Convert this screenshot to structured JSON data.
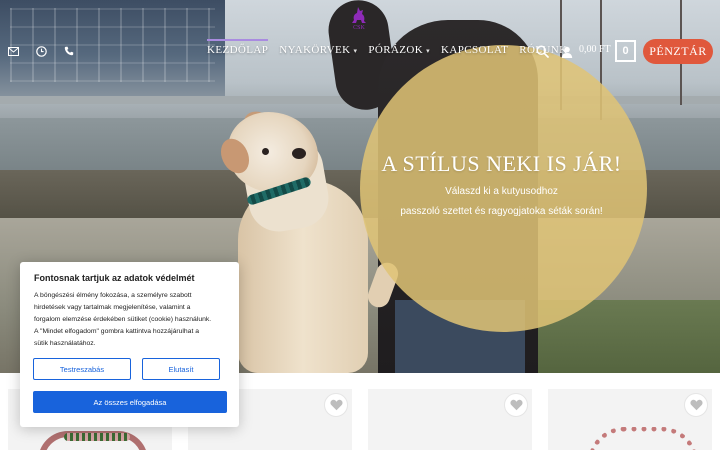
{
  "header": {
    "contact_icons": [
      "envelope-icon",
      "clock-icon",
      "phone-icon"
    ],
    "logo_icon": "dog-silhouette-icon",
    "nav": [
      {
        "label": "KEZDŐLAP",
        "has_dropdown": false,
        "active": true
      },
      {
        "label": "NYAKÖRVEK",
        "has_dropdown": true,
        "active": false
      },
      {
        "label": "PÓRÁZOK",
        "has_dropdown": true,
        "active": false
      },
      {
        "label": "KAPCSOLAT",
        "has_dropdown": false,
        "active": false
      },
      {
        "label": "RÓLUNK",
        "has_dropdown": false,
        "active": false
      }
    ],
    "cart_total": "0,00 FT",
    "cart_count": "0",
    "checkout_label": "PÉNZTÁR"
  },
  "hero": {
    "title": "A STÍLUS NEKI IS JÁR!",
    "subtitle_line1": "Válaszd ki a kutyusodhoz",
    "subtitle_line2": "passzoló szettet és ragyogjatoka séták során!"
  },
  "cookie": {
    "title": "Fontosnak tartjuk az adatok védelmét",
    "text_lines": [
      "A böngészési élmény fokozása, a személyre szabott",
      "hirdetések vagy tartalmak megjelenítése, valamint a",
      "forgalom elemzése érdekében sütiket (cookie) használunk.",
      "A \"Mindet elfogadom\" gombra kattintva hozzájárulhat a",
      "sütik használatához."
    ],
    "customize_label": "Testreszabás",
    "reject_label": "Elutasít",
    "accept_label": "Az összes elfogadása"
  },
  "products": {
    "cards": 4,
    "wishlist_icon": "heart-icon"
  },
  "colors": {
    "accent_nav": "#a98be0",
    "checkout": "#e0583c",
    "hero_circle": "#e0c476",
    "cookie_primary": "#1863dc"
  }
}
